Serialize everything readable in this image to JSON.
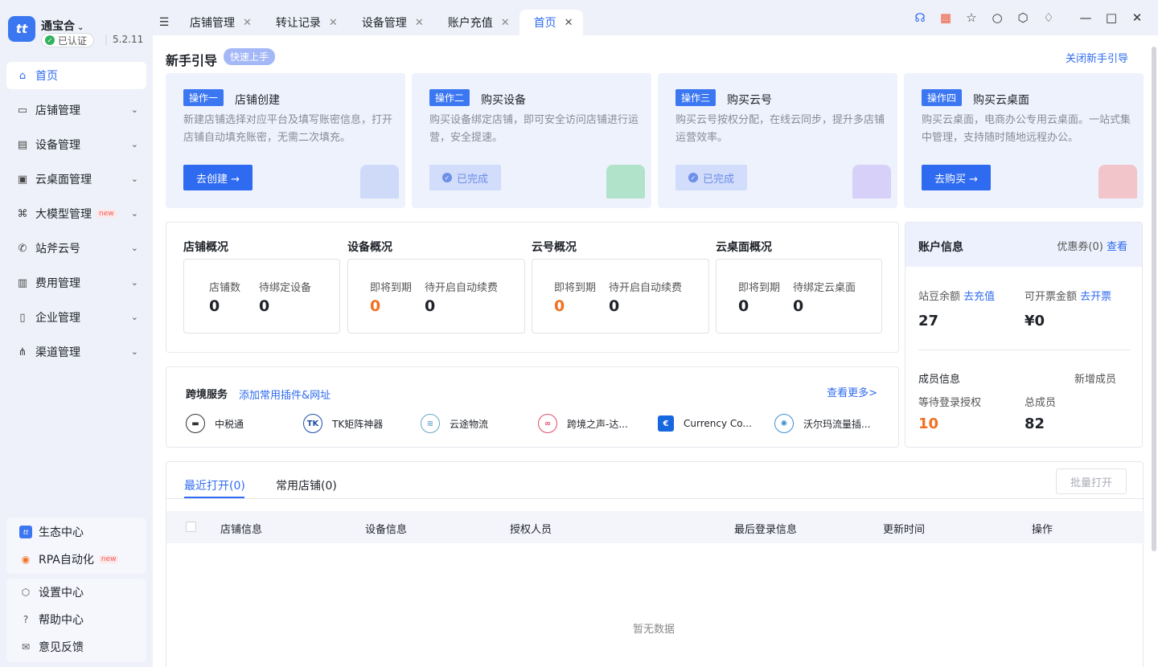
{
  "brand": {
    "logo": "tt",
    "name": "通宝合",
    "verified": "已认证",
    "version": "5.2.11"
  },
  "nav": [
    {
      "label": "首页",
      "icon": "home-icon",
      "glyph": "⌂",
      "active": true
    },
    {
      "label": "店铺管理",
      "icon": "store-icon",
      "glyph": "▭"
    },
    {
      "label": "设备管理",
      "icon": "device-icon",
      "glyph": "▤"
    },
    {
      "label": "云桌面管理",
      "icon": "cloud-desktop-icon",
      "glyph": "▣"
    },
    {
      "label": "大模型管理",
      "icon": "model-icon",
      "glyph": "⌘",
      "tag": "new"
    },
    {
      "label": "站斧云号",
      "icon": "phone-icon",
      "glyph": "✆"
    },
    {
      "label": "费用管理",
      "icon": "fee-icon",
      "glyph": "▥"
    },
    {
      "label": "企业管理",
      "icon": "building-icon",
      "glyph": "▯"
    },
    {
      "label": "渠道管理",
      "icon": "channel-icon",
      "glyph": "⋔"
    }
  ],
  "eco": [
    {
      "label": "生态中心",
      "glyph": "tt"
    },
    {
      "label": "RPA自动化",
      "glyph": "◉",
      "tag": "new"
    }
  ],
  "help": [
    {
      "label": "设置中心",
      "glyph": "⬡"
    },
    {
      "label": "帮助中心",
      "glyph": "?"
    },
    {
      "label": "意见反馈",
      "glyph": "✉"
    }
  ],
  "tabs": [
    {
      "label": "店铺管理"
    },
    {
      "label": "转让记录"
    },
    {
      "label": "设备管理"
    },
    {
      "label": "账户充值"
    },
    {
      "label": "首页",
      "active": true
    }
  ],
  "guide": {
    "title": "新手引导",
    "tag": "快速上手",
    "close": "关闭新手引导",
    "cards": [
      {
        "badge": "操作一",
        "title": "店铺创建",
        "desc": "新建店铺选择对应平台及填写账密信息，打开店铺自动填充账密，无需二次填充。",
        "btn": "去创建 →",
        "state": "action"
      },
      {
        "badge": "操作二",
        "title": "购买设备",
        "desc": "购买设备绑定店铺，即可安全访问店铺进行运营，安全提速。",
        "btn": "已完成",
        "state": "done"
      },
      {
        "badge": "操作三",
        "title": "购买云号",
        "desc": "购买云号按权分配，在线云同步，提升多店铺运营效率。",
        "btn": "已完成",
        "state": "done"
      },
      {
        "badge": "操作四",
        "title": "购买云桌面",
        "desc": "购买云桌面，电商办公专用云桌面。一站式集中管理，支持随时随地远程办公。",
        "btn": "去购买 →",
        "state": "action"
      }
    ]
  },
  "overview": {
    "store": {
      "title": "店铺概况",
      "items": [
        {
          "label": "店铺数",
          "value": "0"
        },
        {
          "label": "待绑定设备",
          "value": "0"
        }
      ]
    },
    "device": {
      "title": "设备概况",
      "items": [
        {
          "label": "即将到期",
          "value": "0"
        },
        {
          "label": "待开启自动续费",
          "value": "0"
        }
      ]
    },
    "cloud": {
      "title": "云号概况",
      "items": [
        {
          "label": "即将到期",
          "value": "0"
        },
        {
          "label": "待开启自动续费",
          "value": "0"
        }
      ]
    },
    "desktop": {
      "title": "云桌面概况",
      "items": [
        {
          "label": "即将到期",
          "value": "0"
        },
        {
          "label": "待绑定云桌面",
          "value": "0"
        }
      ]
    }
  },
  "account": {
    "title": "账户信息",
    "coupon": "优惠券(0)",
    "coupon_link": "查看",
    "balance_label": "站豆余额",
    "balance_link": "去充值",
    "balance": "27",
    "invoice_label": "可开票金额",
    "invoice_link": "去开票",
    "invoice": "¥0",
    "member_title": "成员信息",
    "member_link": "新增成员",
    "pending_label": "等待登录授权",
    "pending": "10",
    "total_label": "总成员",
    "total": "82"
  },
  "services": {
    "title": "跨境服务",
    "add": "添加常用插件&网址",
    "more": "查看更多>",
    "items": [
      {
        "name": "中税通",
        "icon": "zhongshuitong-icon",
        "glyph": "▬",
        "color": "#333"
      },
      {
        "name": "TK矩阵神器",
        "icon": "tk-icon",
        "glyph": "TK",
        "color": "#1e4ea8"
      },
      {
        "name": "云途物流",
        "icon": "yuntu-icon",
        "glyph": "≋",
        "color": "#6aa6c8"
      },
      {
        "name": "跨境之声-达...",
        "icon": "voice-icon",
        "glyph": "∞",
        "color": "#e24a6a"
      },
      {
        "name": "Currency Co...",
        "icon": "currency-icon",
        "glyph": "€",
        "color": "#1767e0"
      },
      {
        "name": "沃尔玛流量插...",
        "icon": "walmart-icon",
        "glyph": "✺",
        "color": "#3d8fd6"
      }
    ]
  },
  "recent": {
    "tab1": "最近打开(0)",
    "tab2": "常用店铺(0)",
    "batch": "批量打开",
    "columns": [
      "店铺信息",
      "设备信息",
      "授权人员",
      "最后登录信息",
      "更新时间",
      "操作"
    ],
    "empty": "暂无数据"
  }
}
